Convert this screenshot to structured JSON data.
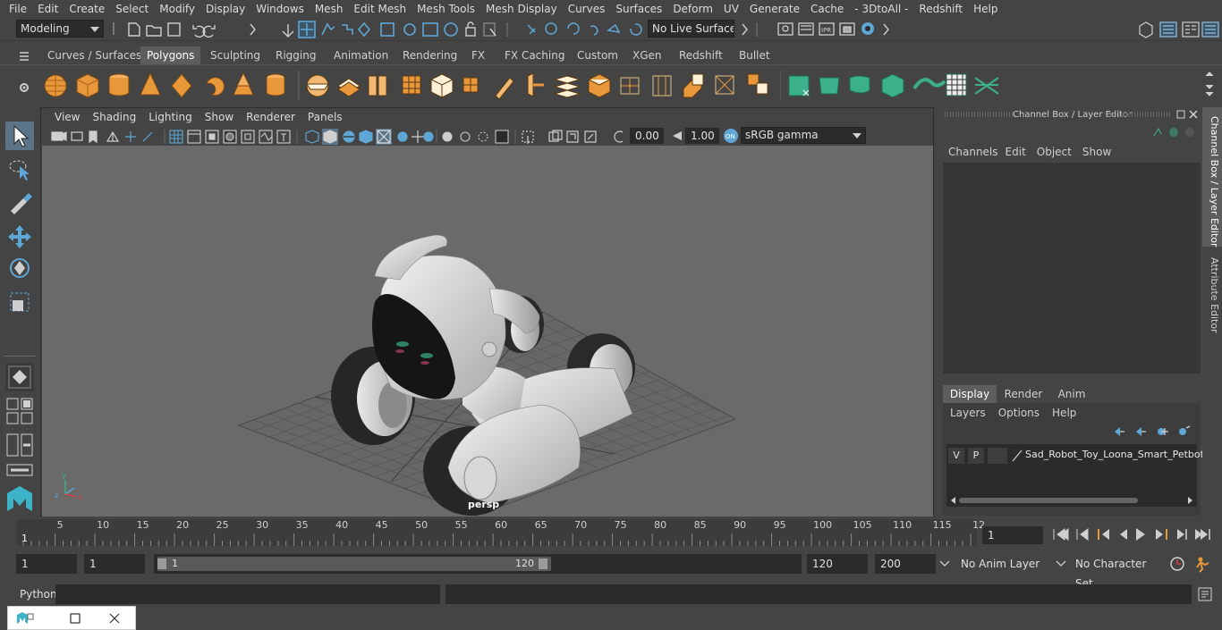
{
  "menubar": {
    "items": [
      "File",
      "Edit",
      "Create",
      "Select",
      "Modify",
      "Display",
      "Windows",
      "Mesh",
      "Edit Mesh",
      "Mesh Tools",
      "Mesh Display",
      "Curves",
      "Surfaces",
      "Deform",
      "UV",
      "Generate",
      "Cache",
      "- 3DtoAll -",
      "Redshift",
      "Help"
    ]
  },
  "statusline": {
    "mode": "Modeling",
    "live_surface": "No Live Surface"
  },
  "shelf_tabs": {
    "items": [
      "Curves / Surfaces",
      "Polygons",
      "Sculpting",
      "Rigging",
      "Animation",
      "Rendering",
      "FX",
      "FX Caching",
      "Custom",
      "XGen",
      "Redshift",
      "Bullet"
    ],
    "active": "Polygons"
  },
  "viewport": {
    "menu": [
      "View",
      "Shading",
      "Lighting",
      "Show",
      "Renderer",
      "Panels"
    ],
    "exposure": "0.00",
    "gamma": "1.00",
    "color_space": "sRGB gamma",
    "camera_label": "persp"
  },
  "channel_box": {
    "title": "Channel Box / Layer Editor",
    "menu": [
      "Channels",
      "Edit",
      "Object",
      "Show"
    ]
  },
  "layer_editor": {
    "tabs": [
      "Display",
      "Render",
      "Anim"
    ],
    "active_tab": "Display",
    "menu": [
      "Layers",
      "Options",
      "Help"
    ],
    "layer": {
      "visible": "V",
      "playback": "P",
      "name": "Sad_Robot_Toy_Loona_Smart_Petbot"
    }
  },
  "side_tabs": [
    "Channel Box / Layer Editor",
    "Attribute Editor"
  ],
  "timeline": {
    "ticks": [
      "5",
      "10",
      "15",
      "20",
      "25",
      "30",
      "35",
      "40",
      "45",
      "50",
      "55",
      "60",
      "65",
      "70",
      "75",
      "80",
      "85",
      "90",
      "95",
      "100",
      "105",
      "110",
      "115",
      "12"
    ],
    "start_label": "1",
    "current_frame": "1"
  },
  "range": {
    "start": "1",
    "playback_start": "1",
    "slider_start": "1",
    "slider_end": "120",
    "playback_end": "120",
    "end": "200",
    "anim_layer": "No Anim Layer",
    "character_set": "No Character Set"
  },
  "cmdline": {
    "label": "Python"
  },
  "colors": {
    "accent_blue": "#5ea6d6",
    "shelf_orange": "#e8973a",
    "shelf_green": "#3cb08a"
  }
}
